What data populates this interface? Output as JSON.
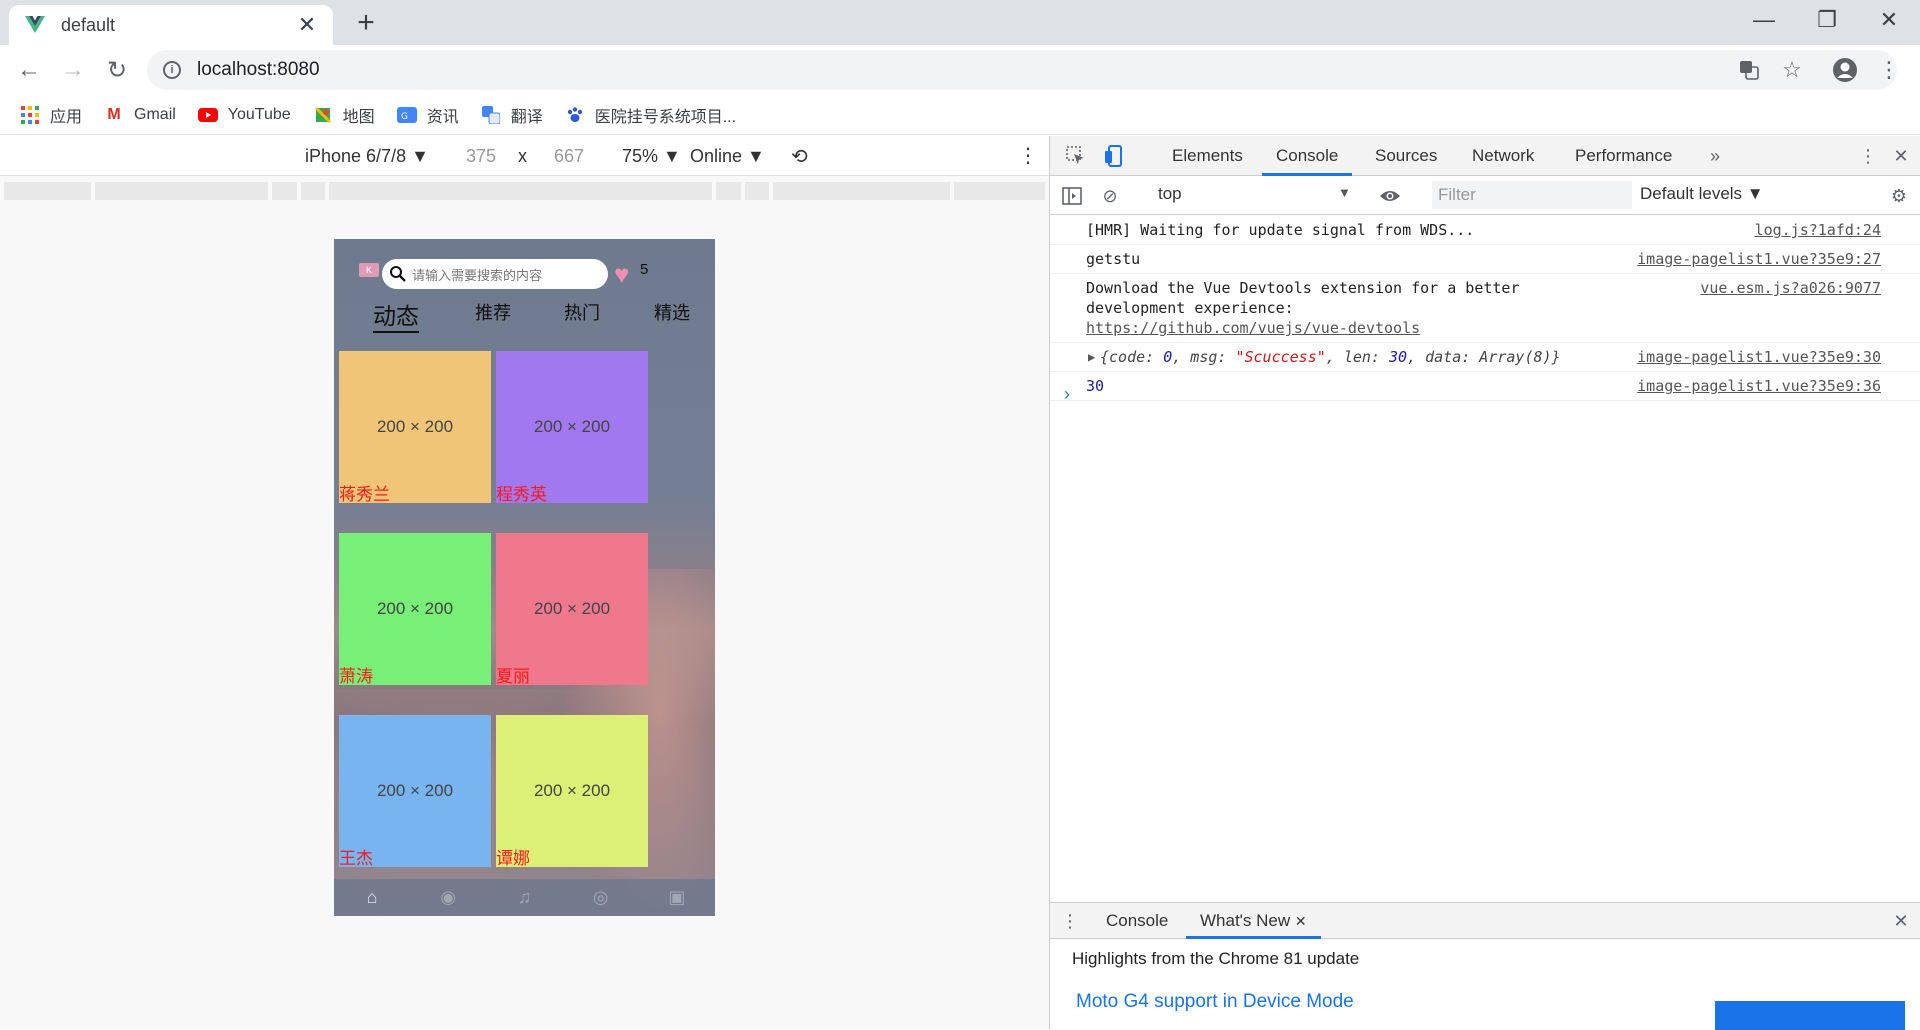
{
  "browser": {
    "tab_title": "default",
    "url": "localhost:8080",
    "bookmarks": [
      {
        "label": "应用",
        "icon": "apps-grid-icon"
      },
      {
        "label": "Gmail",
        "icon": "gmail-icon"
      },
      {
        "label": "YouTube",
        "icon": "youtube-icon"
      },
      {
        "label": "地图",
        "icon": "maps-icon"
      },
      {
        "label": "资讯",
        "icon": "news-icon"
      },
      {
        "label": "翻译",
        "icon": "translate-icon"
      },
      {
        "label": "医院挂号系统项目...",
        "icon": "paw-icon"
      }
    ]
  },
  "device_toolbar": {
    "device": "iPhone 6/7/8",
    "width": "375",
    "x": "x",
    "height": "667",
    "zoom": "75%",
    "network": "Online"
  },
  "app": {
    "search_placeholder": "请输入需要搜索的内容",
    "count": "5",
    "tabs": [
      "动态",
      "推荐",
      "热门",
      "精选"
    ],
    "cards": [
      {
        "label": "200 × 200",
        "name": "蒋秀兰",
        "color": "#f0c578"
      },
      {
        "label": "200 × 200",
        "name": "程秀英",
        "color": "#a278f0"
      },
      {
        "label": "200 × 200",
        "name": "萧涛",
        "color": "#78f078"
      },
      {
        "label": "200 × 200",
        "name": "夏丽",
        "color": "#f0788c"
      },
      {
        "label": "200 × 200",
        "name": "王杰",
        "color": "#78b4f0"
      },
      {
        "label": "200 × 200",
        "name": "谭娜",
        "color": "#dcf078"
      }
    ]
  },
  "devtools": {
    "tabs": [
      "Elements",
      "Console",
      "Sources",
      "Network",
      "Performance"
    ],
    "context": "top",
    "filter_placeholder": "Filter",
    "levels": "Default levels",
    "log": [
      {
        "text": "[HMR] Waiting for update signal from WDS...",
        "src": "log.js?1afd:24"
      },
      {
        "text": "getstu",
        "src": "image-pagelist1.vue?35e9:27"
      },
      {
        "text": "Download the Vue Devtools extension for a better development experience:",
        "link": "https://github.com/vuejs/vue-devtools",
        "src": "vue.esm.js?a026:9077"
      },
      {
        "obj_prefix": "{code: ",
        "code": "0",
        "msg_key": ", msg: ",
        "msg": "\"Scuccess\"",
        "len_key": ", len: ",
        "len": "30",
        "data_key": ", data: Array(8)}",
        "src": "image-pagelist1.vue?35e9:30"
      },
      {
        "text": "30",
        "src": "image-pagelist1.vue?35e9:36"
      }
    ],
    "drawer_tabs": [
      "Console",
      "What's New"
    ],
    "drawer_heading": "Highlights from the Chrome 81 update",
    "drawer_link": "Moto G4 support in Device Mode"
  }
}
